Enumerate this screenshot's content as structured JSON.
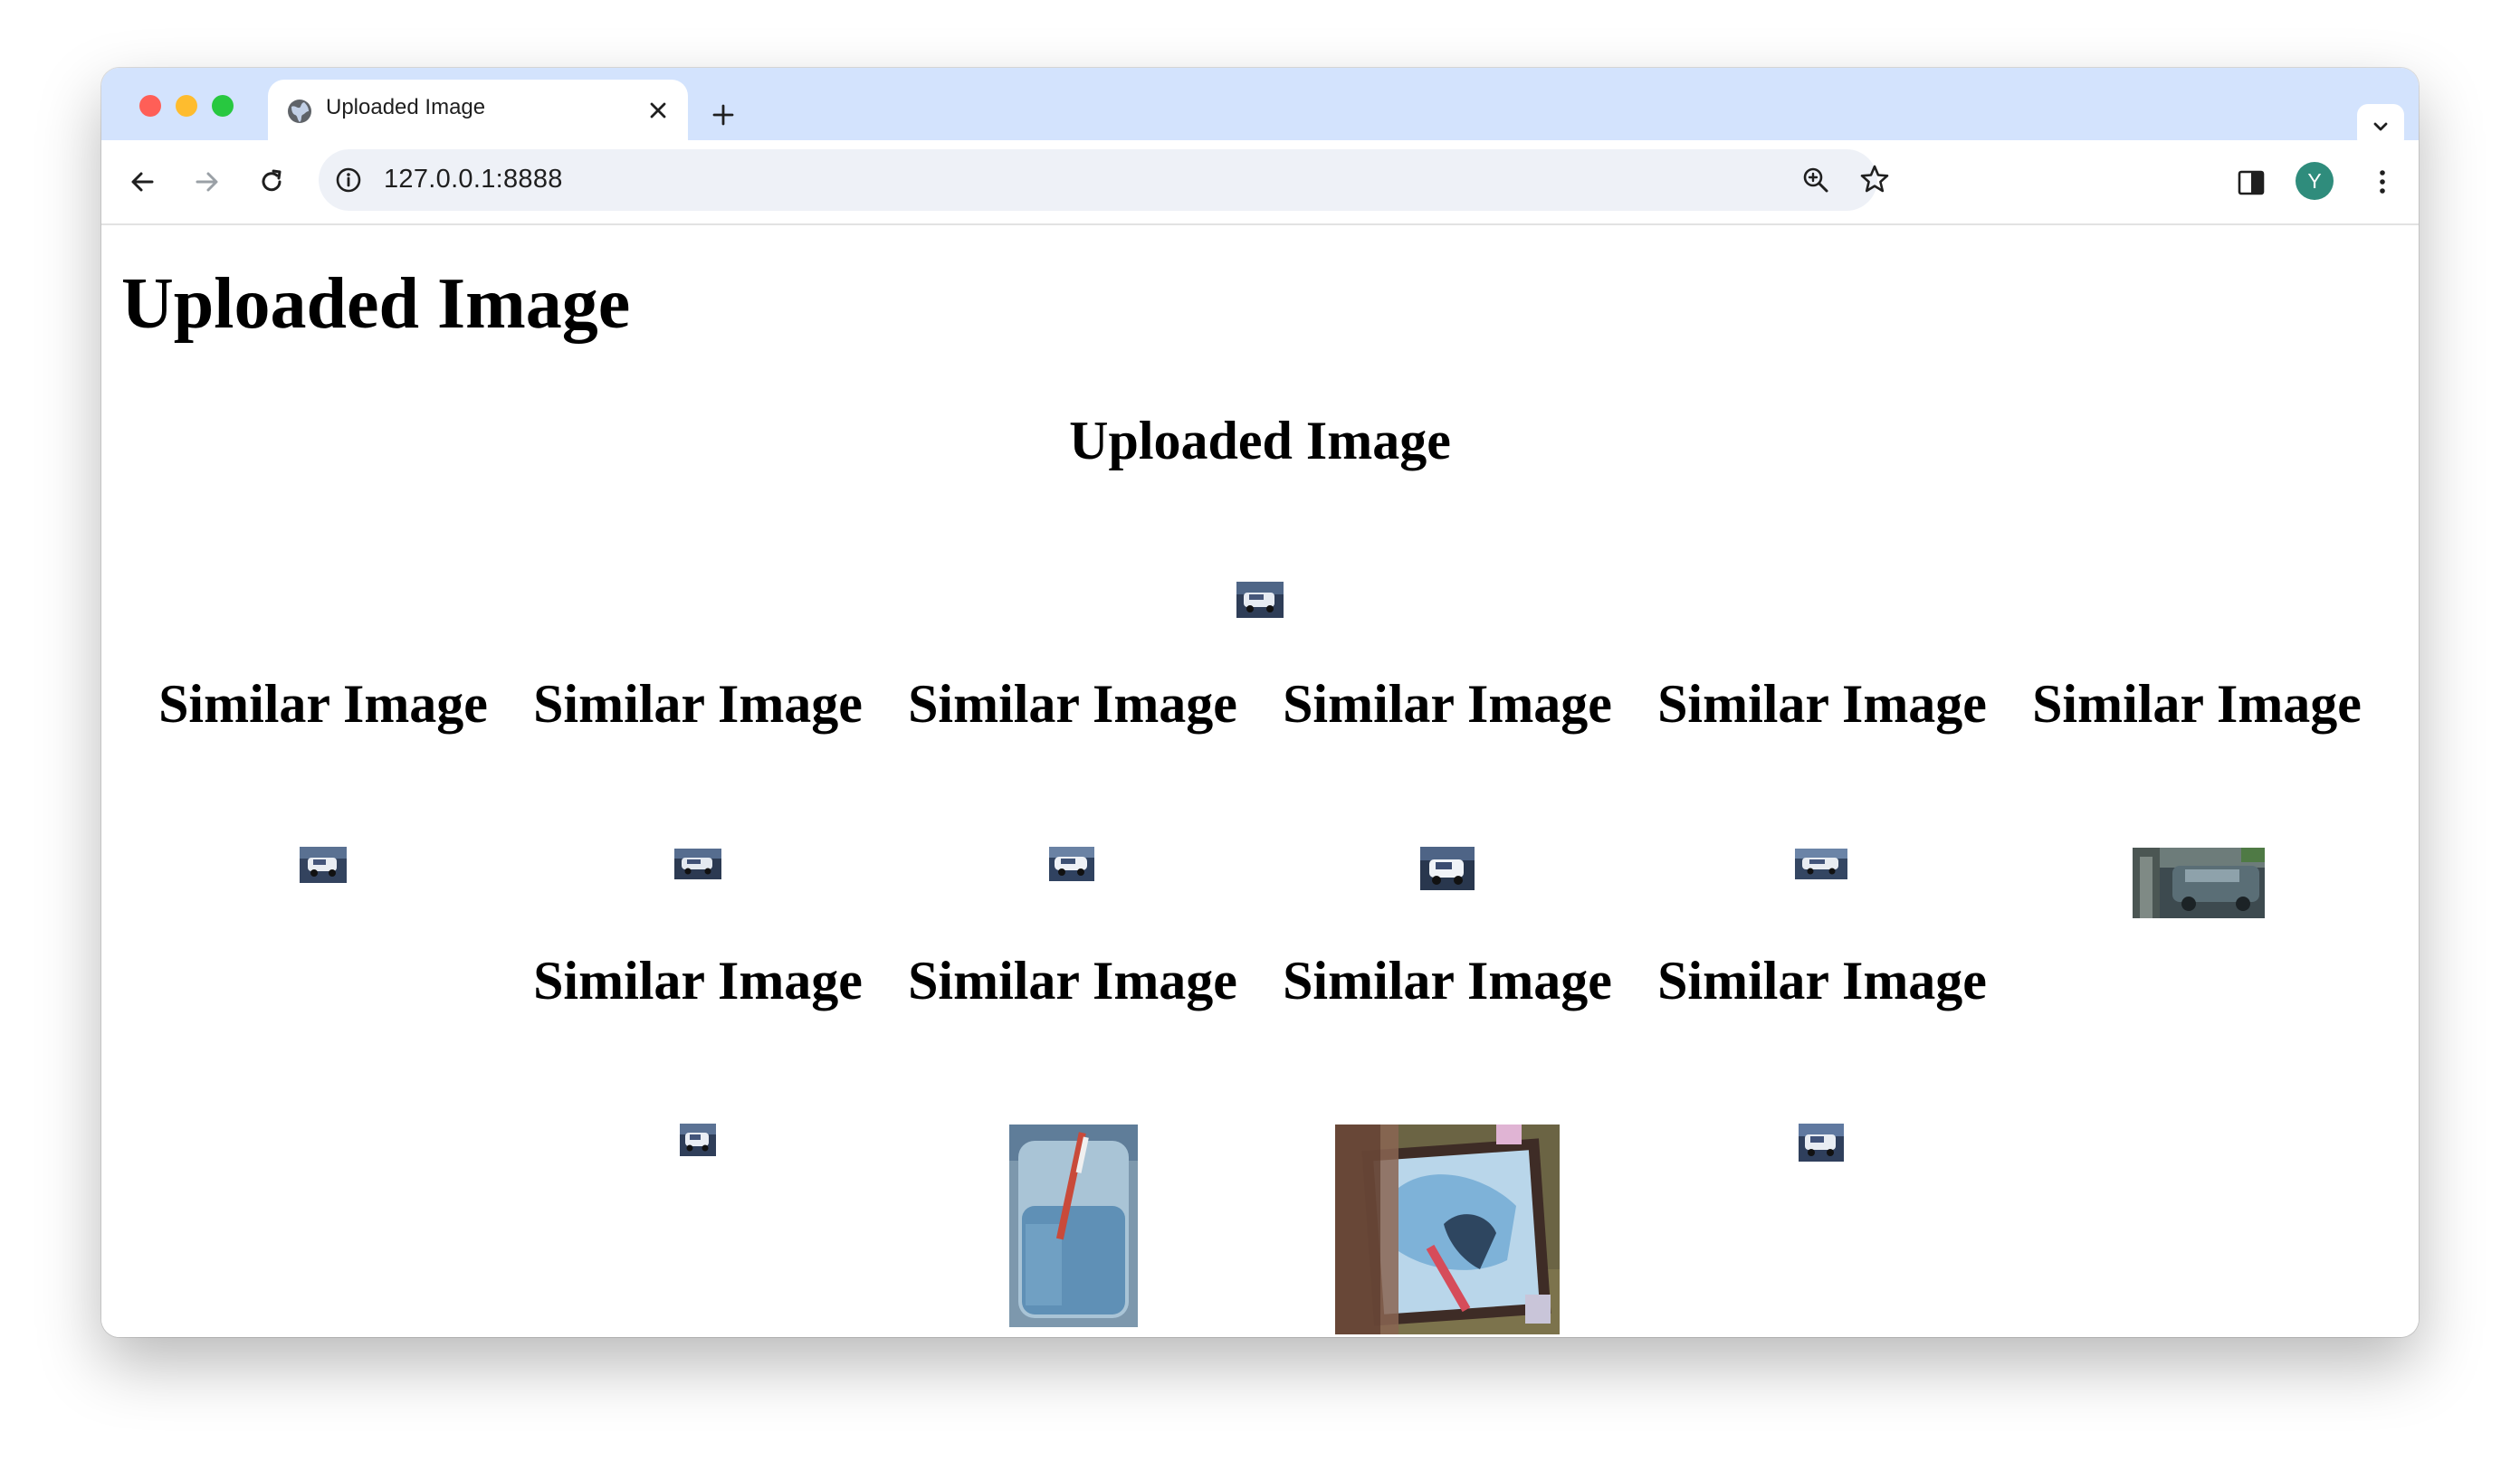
{
  "browser": {
    "tab": {
      "title": "Uploaded Image"
    },
    "address_bar": {
      "url": "127.0.0.1:8888"
    },
    "profile": {
      "initial": "Y"
    }
  },
  "page": {
    "heading": "Uploaded Image",
    "uploaded_section": {
      "heading": "Uploaded Image",
      "image": "car-thumbnail"
    },
    "similar_images": [
      {
        "label": "Similar Image",
        "image": "car-thumbnail"
      },
      {
        "label": "Similar Image",
        "image": "car-thumbnail"
      },
      {
        "label": "Similar Image",
        "image": "car-thumbnail"
      },
      {
        "label": "Similar Image",
        "image": "car-thumbnail"
      },
      {
        "label": "Similar Image",
        "image": "car-thumbnail"
      },
      {
        "label": "Similar Image",
        "image": "parked-cars-photo"
      },
      {
        "label": "Similar Image",
        "image": "car-thumbnail"
      },
      {
        "label": "Similar Image",
        "image": "blue-paint-jar-photo"
      },
      {
        "label": "Similar Image",
        "image": "child-painting-photo"
      },
      {
        "label": "Similar Image",
        "image": "car-thumbnail"
      }
    ]
  }
}
